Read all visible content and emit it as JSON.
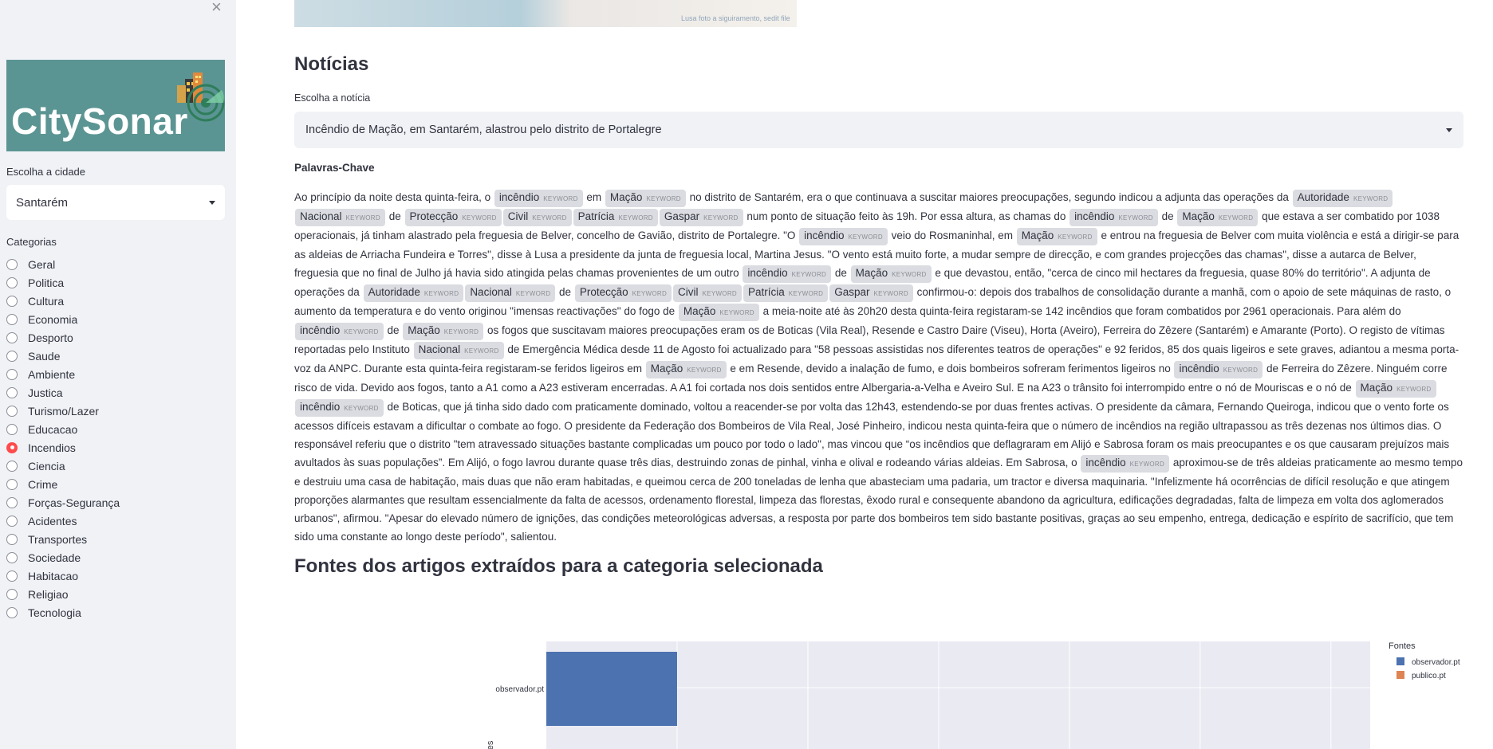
{
  "sidebar": {
    "close_glyph": "×",
    "logo_text": "CitySonar",
    "city_label": "Escolha a cidade",
    "city_value": "Santarém",
    "categories_label": "Categorias",
    "categories": [
      "Geral",
      "Politica",
      "Cultura",
      "Economia",
      "Desporto",
      "Saude",
      "Ambiente",
      "Justica",
      "Turismo/Lazer",
      "Educacao",
      "Incendios",
      "Ciencia",
      "Crime",
      "Forças-Segurança",
      "Acidentes",
      "Transportes",
      "Sociedade",
      "Habitacao",
      "Religiao",
      "Tecnologia"
    ],
    "selected_category": "Incendios"
  },
  "main": {
    "banner_caption": "Lusa foto a siguiramento, sedit file",
    "title": "Notícias",
    "news_label": "Escolha a notícia",
    "news_value": "Incêndio de Mação, em Santarém, alastrou pelo distrito de Portalegre",
    "keywords_heading": "Palavras-Chave",
    "keyword_tag": "KEYWORD",
    "article": [
      {
        "t": "Ao princípio da noite desta quinta-feira, o "
      },
      {
        "k": "incêndio"
      },
      {
        "t": " em "
      },
      {
        "k": "Mação"
      },
      {
        "t": " no distrito de Santarém, era o que continuava a suscitar maiores preocupações, segundo indicou a adjunta das operações da "
      },
      {
        "k": "Autoridade"
      },
      {
        "k": "Nacional"
      },
      {
        "t": " de "
      },
      {
        "k": "Protecção"
      },
      {
        "k": "Civil"
      },
      {
        "k": "Patrícia"
      },
      {
        "k": "Gaspar"
      },
      {
        "t": " num ponto de situação feito às 19h. Por essa altura, as chamas do "
      },
      {
        "k": "incêndio"
      },
      {
        "t": " de "
      },
      {
        "k": "Mação"
      },
      {
        "t": " que estava a ser combatido por 1038 operacionais, já tinham alastrado pela freguesia de Belver, concelho de Gavião, distrito de Portalegre. \"O "
      },
      {
        "k": "incêndio"
      },
      {
        "t": " veio do Rosmaninhal, em "
      },
      {
        "k": "Mação"
      },
      {
        "t": " e entrou na freguesia de Belver com muita violência e está a dirigir-se para as aldeias de Arriacha Fundeira e Torres\", disse à Lusa a presidente da junta de freguesia local, Martina Jesus. \"O vento está muito forte, a mudar sempre de direcção, e com grandes projecções das chamas\", disse a autarca de Belver, freguesia que no final de Julho já havia sido atingida pelas chamas provenientes de um outro "
      },
      {
        "k": "incêndio"
      },
      {
        "t": " de "
      },
      {
        "k": "Mação"
      },
      {
        "t": " e que devastou, então, \"cerca de cinco mil hectares da freguesia, quase 80% do território\". A adjunta de operações da "
      },
      {
        "k": "Autoridade"
      },
      {
        "k": "Nacional"
      },
      {
        "t": " de "
      },
      {
        "k": "Protecção"
      },
      {
        "k": "Civil"
      },
      {
        "k": "Patrícia"
      },
      {
        "k": "Gaspar"
      },
      {
        "t": " confirmou-o: depois dos trabalhos de consolidação durante a manhã, com o apoio de sete máquinas de rasto, o aumento da temperatura e do vento originou \"imensas reactivações\" do fogo de "
      },
      {
        "k": "Mação"
      },
      {
        "t": " a meia-noite até às 20h20 desta quinta-feira registaram-se 142 incêndios que foram combatidos por 2961 operacionais. Para além do "
      },
      {
        "k": "incêndio"
      },
      {
        "t": " de "
      },
      {
        "k": "Mação"
      },
      {
        "t": " os fogos que suscitavam maiores preocupações eram os de Boticas (Vila Real), Resende e Castro Daire (Viseu), Horta (Aveiro), Ferreira do Zêzere (Santarém) e Amarante (Porto). O registo de vítimas reportadas pelo Instituto "
      },
      {
        "k": "Nacional"
      },
      {
        "t": " de Emergência Médica desde 11 de Agosto foi actualizado para \"58 pessoas assistidas nos diferentes teatros de operações\" e 92 feridos, 85 dos quais ligeiros e sete graves, adiantou a mesma porta-voz da ANPC. Durante esta quinta-feira registaram-se feridos ligeiros em "
      },
      {
        "k": "Mação"
      },
      {
        "t": " e em Resende, devido a inalação de fumo, e dois bombeiros sofreram ferimentos ligeiros no "
      },
      {
        "k": "incêndio"
      },
      {
        "t": " de Ferreira do Zêzere. Ninguém corre risco de vida. Devido aos fogos, tanto a A1 como a A23 estiveram encerradas. A A1 foi cortada nos dois sentidos entre Albergaria-a-Velha e Aveiro Sul. E na A23 o trânsito foi interrompido entre o nó de Mouriscas e o nó de "
      },
      {
        "k": "Mação"
      },
      {
        "k": "incêndio"
      },
      {
        "t": " de Boticas, que já tinha sido dado com praticamente dominado, voltou a reacender-se por volta das 12h43, estendendo-se por duas frentes activas. O presidente da câmara, Fernando Queiroga, indicou que o vento forte os acessos difíceis estavam a dificultar o combate ao fogo. O presidente da Federação dos Bombeiros de Vila Real, José Pinheiro, indicou nesta quinta-feira que o número de incêndios na região ultrapassou as três dezenas nos últimos dias. O responsável referiu que o distrito \"tem atravessado situações bastante complicadas um pouco por todo o lado\", mas vincou que “os incêndios que deflagraram em Alijó e Sabrosa foram os mais preocupantes e os que causaram prejuízos mais avultados às suas populações”. Em Alijó, o fogo lavrou durante quase três dias, destruindo zonas de pinhal, vinha e olival e rodeando várias aldeias. Em Sabrosa, o "
      },
      {
        "k": "incêndio"
      },
      {
        "t": " aproximou-se de três aldeias praticamente ao mesmo tempo e destruiu uma casa de habitação, mais duas que não eram habitadas, e queimou cerca de 200 toneladas de lenha que abasteciam uma padaria, um tractor e diversa maquinaria. \"Infelizmente há ocorrências de difícil resolução e que atingem proporções alarmantes que resultam essencialmente da falta de acessos, ordenamento florestal, limpeza das florestas, êxodo rural e consequente abandono da agricultura, edificações degradadas, falta de limpeza em volta dos aglomerados urbanos\", afirmou. \"Apesar do elevado número de ignições, das condições meteorológicas adversas, a resposta por parte dos bombeiros tem sido bastante positivas, graças ao seu empenho, entrega, dedicação e espírito de sacrifício, que tem sido uma constante ao longo deste período\", salientou."
      }
    ],
    "sources_heading": "Fontes dos artigos extraídos para a categoria selecionada"
  },
  "chart_data": {
    "type": "bar",
    "orientation": "horizontal",
    "categories": [
      "observador.pt"
    ],
    "series": [
      {
        "name": "observador.pt",
        "color": "#4c72b0",
        "values": [
          1
        ]
      },
      {
        "name": "publico.pt",
        "color": "#dd8452",
        "values": [
          0
        ]
      }
    ],
    "ylabel": "ntes",
    "legend_title": "Fontes",
    "legend_position": "top-right",
    "grid": true
  }
}
